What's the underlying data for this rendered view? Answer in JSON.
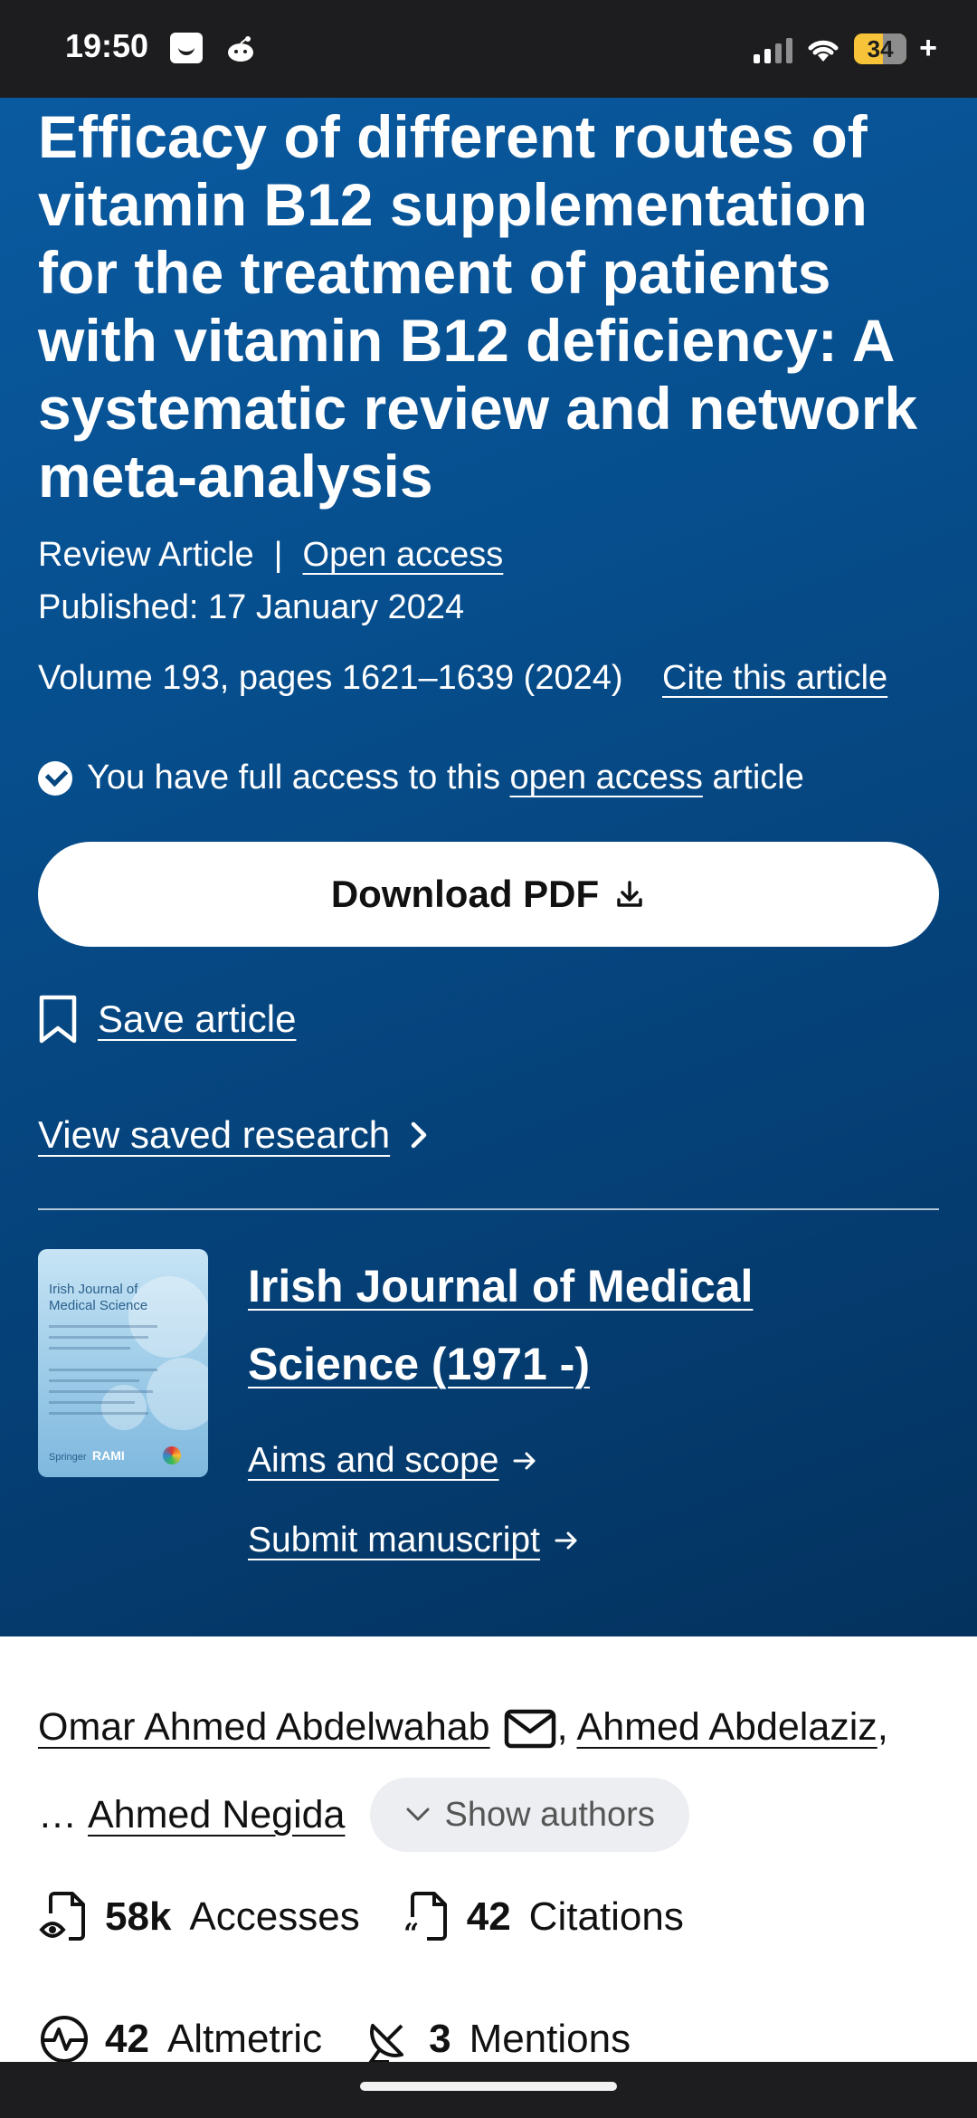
{
  "status_bar": {
    "time": "19:50",
    "battery": "34",
    "battery_plus": "+"
  },
  "article": {
    "title": "Efficacy of different routes of vitamin B12 supplementation for the treatment of patients with vitamin B12 deficiency: A systematic review and network meta-analysis",
    "type": "Review Article",
    "separator": "|",
    "access_link": "Open access",
    "published": "Published: 17 January 2024",
    "volume": "Volume 193, pages 1621–1639 (2024)",
    "cite_link": "Cite this article",
    "access_pre": "You have full access to this",
    "access_mid": "open access",
    "access_post": "article",
    "download_label": "Download PDF",
    "save_label": "Save article",
    "view_saved_label": "View saved research"
  },
  "journal": {
    "name": "Irish Journal of Medical Science (1971 -)",
    "aims_label": "Aims and scope",
    "submit_label": "Submit manuscript",
    "cover": {
      "title1": "Irish Journal of",
      "title2": "Medical Science",
      "publisher1": "Springer",
      "publisher2": "RAMI"
    }
  },
  "authors": {
    "first": "Omar Ahmed Abdelwahab",
    "comma1": ",",
    "second": "Ahmed Abdelaziz",
    "comma2": ",",
    "ellipsis": "…",
    "last": "Ahmed Negida",
    "show_label": "Show authors"
  },
  "metrics": {
    "accesses_value": "58k",
    "accesses_label": "Accesses",
    "citations_value": "42",
    "citations_label": "Citations",
    "altmetric_value": "42",
    "altmetric_label": "Altmetric",
    "mentions_value": "3",
    "mentions_label": "Mentions"
  },
  "colors": {
    "hero_blue": "#064e8d",
    "button_bg": "#ffffff",
    "chip_bg": "#eceef1"
  }
}
